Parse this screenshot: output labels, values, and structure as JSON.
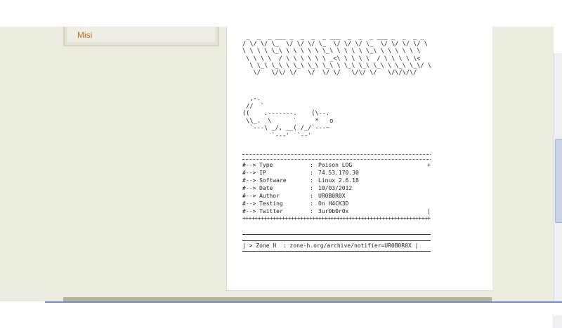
{
  "sidebar": {
    "link_label": "Misi"
  },
  "banner_ascii": " _  _  _ ___ _  _  _  _ ___  _  _  _ ___ _  _  _ _\n/ \\/ \\/ \\_  \\/ \\/ \\/ \\_  \\/ \\/ \\/ \\_  \\/ \\/ \\/ \\/ \\\n\\ \\ \\ \\ \\_\\ \\ \\ \\ \\ \\ \\_\\ \\ \\ \\ \\ \\_\\ \\ \\ \\ \\ \\ \\\n \\ \\ \\ \\  / \\ \\ \\ \\ \\ \\ _<\\ \\ \\ \\ \\  / \\ \\ \\ \\ \\< \n  \\ \\_\\ \\_\\ \\ \\_\\ \\_\\ \\_\\ \\ \\_\\ \\_\\ \\_\\ \\ \\_\\ \\_\\/ \\\n   \\/   \\/\\/ \\/   \\/  \\/ \\/   \\/\\/ \\/   \\/\\/\\/\\/ ",
  "logo_ascii": "  ,-.\n //  `\n((    .-------.    (\\--.\n \\\\_.  \\      `     *   o\n  `---\\ _/, __( /_/`---~\n        `---'  `--'",
  "info": {
    "rows": [
      {
        "key": "#--> Type",
        "value": "Poison LOG",
        "end": "+"
      },
      {
        "key": "#--> IP",
        "value": "74.53.170.30",
        "end": ""
      },
      {
        "key": "#--> Software",
        "value": "Linux 2.6.18",
        "end": ""
      },
      {
        "key": "#--> Date",
        "value": "10/03/2012",
        "end": ""
      },
      {
        "key": "#--> Author",
        "value": "UR0B0R0X",
        "end": ""
      },
      {
        "key": "#--> Testing",
        "value": "On H4CK3D",
        "end": ""
      },
      {
        "key": "#--> Twitter",
        "value": "3ur0b0r0x",
        "end": "|"
      }
    ],
    "plus_rule": "+++++++++++++++++++++++++++++++++++++++++++++++++++++++++++++++"
  },
  "zone": {
    "text": "| > Zone H  : zone-h.org/archive/notifier=UR0B0R0X |"
  }
}
